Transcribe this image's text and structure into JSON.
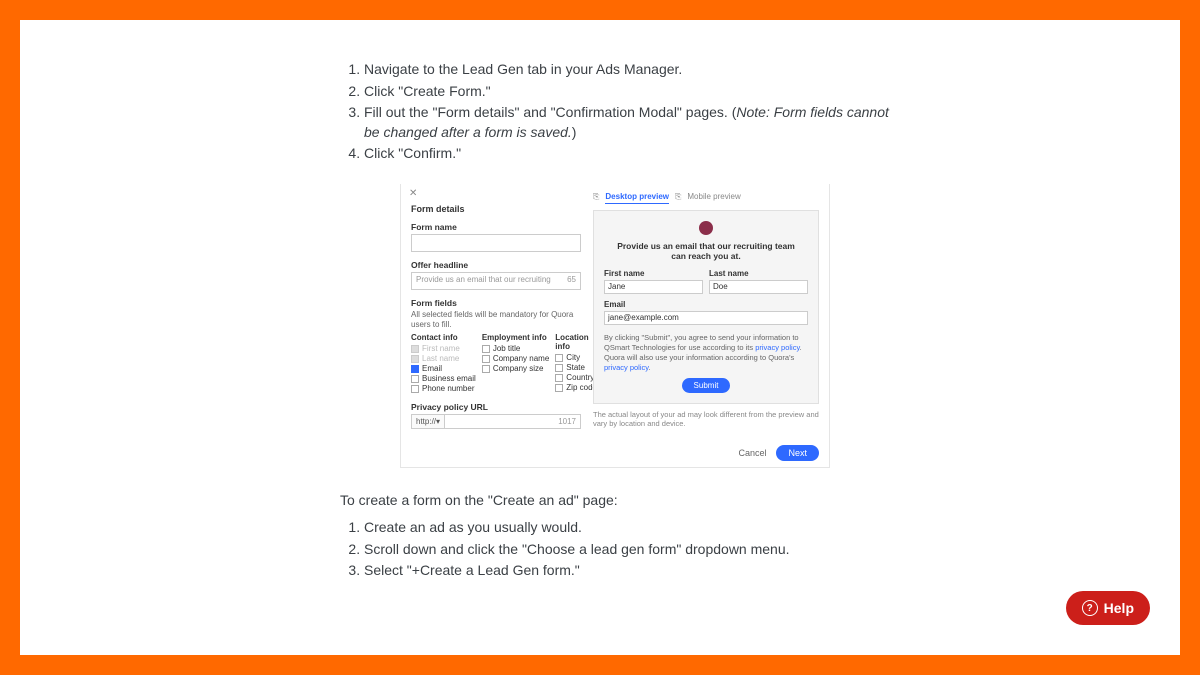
{
  "steps_a": {
    "s1": "Navigate to the Lead Gen tab in your Ads Manager.",
    "s2": "Click \"Create Form.\"",
    "s3_pre": "Fill out the \"Form details\" and \"Confirmation Modal\" pages. (",
    "s3_note": "Note: Form fields cannot be changed after a form is saved.",
    "s3_post": ")",
    "s4": "Click \"Confirm.\""
  },
  "intro_b": "To create a form on the \"Create an ad\" page:",
  "steps_b": {
    "s1": "Create an ad as you usually would.",
    "s2": "Scroll down and click the \"Choose a lead gen form\" dropdown menu.",
    "s3": "Select \"+Create a Lead Gen form.\""
  },
  "panel": {
    "title": "Form details",
    "formName": "Form name",
    "offerHeadline": {
      "label": "Offer headline",
      "placeholder": "Provide us an email that our recruiting",
      "count": "65"
    },
    "formFields": {
      "label": "Form fields",
      "help": "All selected fields will be mandatory for Quora users to fill.",
      "cols": {
        "contact": {
          "title": "Contact info",
          "i1": "First name",
          "i2": "Last name",
          "i3": "Email",
          "i4": "Business email",
          "i5": "Phone number"
        },
        "employment": {
          "title": "Employment info",
          "i1": "Job title",
          "i2": "Company name",
          "i3": "Company size"
        },
        "location": {
          "title": "Location info",
          "i1": "City",
          "i2": "State",
          "i3": "Country",
          "i4": "Zip code"
        }
      }
    },
    "privacy": {
      "label": "Privacy policy URL",
      "proto": "http://▾",
      "count": "1017"
    }
  },
  "preview": {
    "tabs": {
      "desktop": "Desktop preview",
      "mobile": "Mobile preview"
    },
    "headline": "Provide us an email that our recruiting team can reach you at.",
    "first": {
      "label": "First name",
      "value": "Jane"
    },
    "last": {
      "label": "Last name",
      "value": "Doe"
    },
    "email": {
      "label": "Email",
      "value": "jane@example.com"
    },
    "disclaimer": {
      "p1": "By clicking \"Submit\", you agree to send your information to QSmart Technologies for use according to its ",
      "l1": "privacy policy",
      "p2": ". Quora will also use your information according to Quora's ",
      "l2": "privacy policy",
      "p3": "."
    },
    "submit": "Submit",
    "note": "The actual layout of your ad may look different from the preview and vary by location and device."
  },
  "footer": {
    "cancel": "Cancel",
    "next": "Next"
  },
  "help": "Help"
}
